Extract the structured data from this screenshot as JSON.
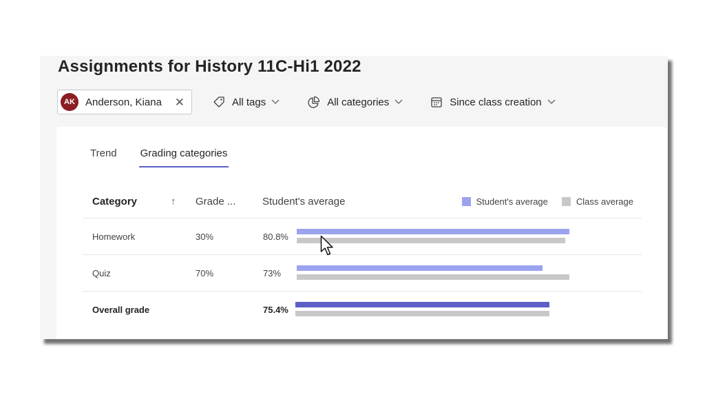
{
  "page": {
    "title": "Assignments for History 11C-Hi1 2022"
  },
  "filters": {
    "student": {
      "initials": "AK",
      "name": "Anderson, Kiana",
      "avatar_color": "#8b1d23"
    },
    "tags_label": "All tags",
    "categories_label": "All categories",
    "date_label": "Since class creation"
  },
  "tabs": [
    {
      "label": "Trend",
      "active": false
    },
    {
      "label": "Grading categories",
      "active": true
    }
  ],
  "table": {
    "headers": {
      "category": "Category",
      "sort": "↑",
      "grade": "Grade ...",
      "average": "Student's average"
    },
    "legend": {
      "student": "Student's average",
      "class": "Class average"
    },
    "rows": [
      {
        "category": "Homework",
        "weight": "30%",
        "average_label": "80.8%",
        "student_pct": 80.8,
        "class_pct": 79.6
      },
      {
        "category": "Quiz",
        "weight": "70%",
        "average_label": "73%",
        "student_pct": 72.9,
        "class_pct": 80.8
      },
      {
        "category": "Overall grade",
        "weight": "",
        "average_label": "75.4%",
        "student_pct": 75.4,
        "class_pct": 75.4
      }
    ]
  },
  "colors": {
    "accent": "#5b5fc7",
    "student_bar": "#9ba3ee",
    "class_bar": "#c8c8c8"
  }
}
